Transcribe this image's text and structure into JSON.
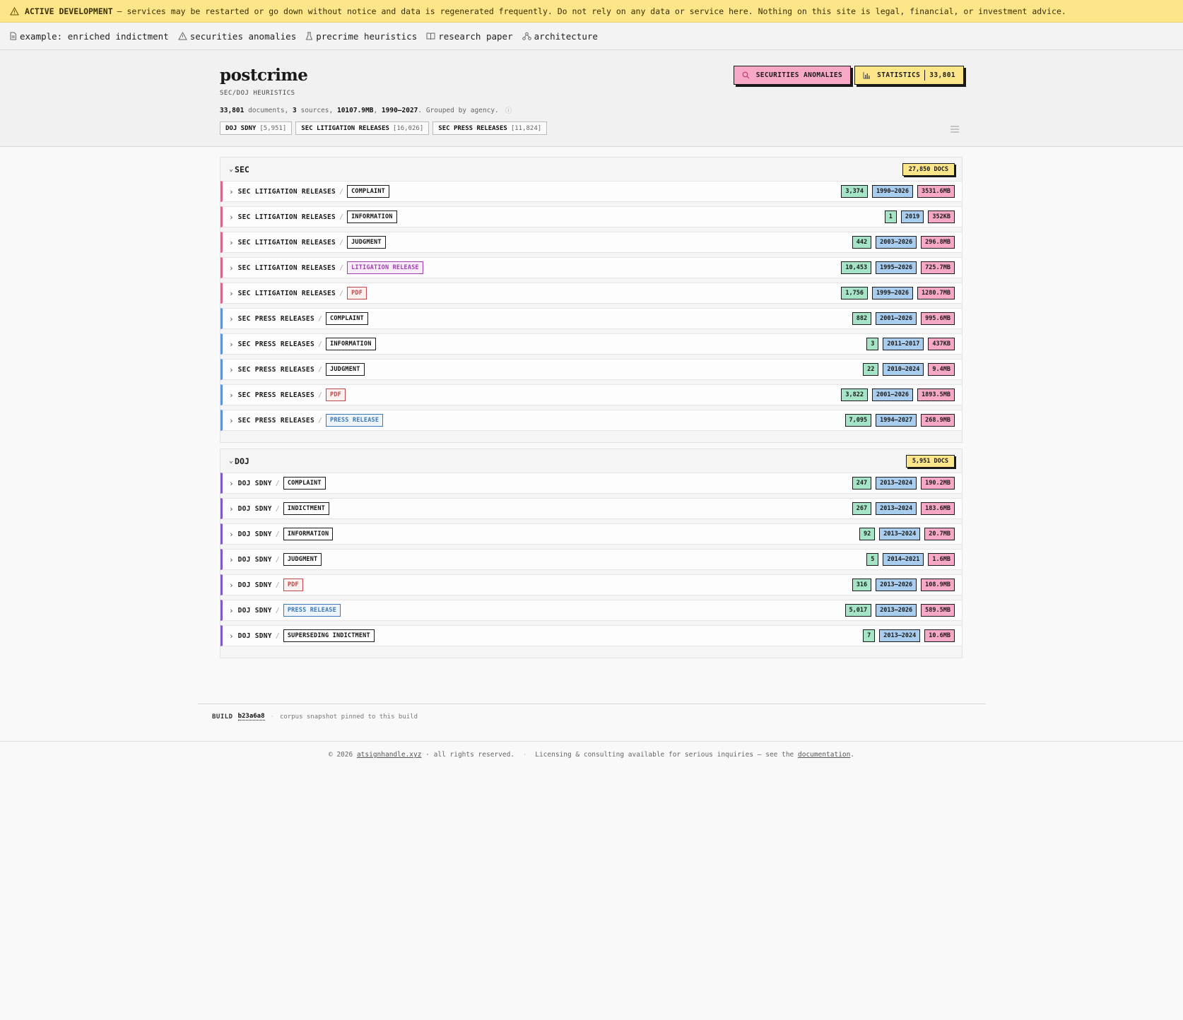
{
  "banner": {
    "icon": "warning-triangle-icon",
    "title": "ACTIVE DEVELOPMENT",
    "text": "— services may be restarted or go down without notice and data is regenerated frequently. Do not rely on any data or service here. Nothing on this site is legal, financial, or investment advice."
  },
  "nav": [
    {
      "icon": "file-icon",
      "label": "example: enriched indictment"
    },
    {
      "icon": "warning-icon",
      "label": "securities anomalies"
    },
    {
      "icon": "flask-icon",
      "label": "precrime heuristics"
    },
    {
      "icon": "book-icon",
      "label": "research paper"
    },
    {
      "icon": "network-icon",
      "label": "architecture"
    }
  ],
  "header": {
    "title": "postcrime",
    "subtitle": "SEC/DOJ HEURISTICS",
    "stats": {
      "documents": "33,801",
      "documents_label": "documents,",
      "sources": "3",
      "sources_label": "sources,",
      "size": "10107.9MB",
      "range": "1990–2027",
      "grouped": ". Grouped by agency."
    },
    "buttons": {
      "anomalies": "SECURITIES ANOMALIES",
      "statistics": "STATISTICS",
      "statistics_count": "33,801"
    },
    "sources": [
      {
        "name": "DOJ SDNY",
        "count": "[5,951]"
      },
      {
        "name": "SEC LITIGATION RELEASES",
        "count": "[16,026]"
      },
      {
        "name": "SEC PRESS RELEASES",
        "count": "[11,824]"
      }
    ]
  },
  "groups": [
    {
      "name": "SEC",
      "docs": "27,850 DOCS",
      "rows": [
        {
          "source": "SEC LITIGATION RELEASES",
          "tag": "COMPLAINT",
          "tag_style": "plain",
          "accent": "lit",
          "count": "3,374",
          "years": "1990–2026",
          "size": "3531.6MB"
        },
        {
          "source": "SEC LITIGATION RELEASES",
          "tag": "INFORMATION",
          "tag_style": "plain",
          "accent": "lit",
          "count": "1",
          "years": "2019",
          "size": "352KB"
        },
        {
          "source": "SEC LITIGATION RELEASES",
          "tag": "JUDGMENT",
          "tag_style": "plain",
          "accent": "lit",
          "count": "442",
          "years": "2003–2026",
          "size": "296.8MB"
        },
        {
          "source": "SEC LITIGATION RELEASES",
          "tag": "LITIGATION RELEASE",
          "tag_style": "lit",
          "accent": "lit",
          "count": "10,453",
          "years": "1995–2026",
          "size": "725.7MB"
        },
        {
          "source": "SEC LITIGATION RELEASES",
          "tag": "PDF",
          "tag_style": "pdf",
          "accent": "lit",
          "count": "1,756",
          "years": "1999–2026",
          "size": "1280.7MB"
        },
        {
          "source": "SEC PRESS RELEASES",
          "tag": "COMPLAINT",
          "tag_style": "plain",
          "accent": "press",
          "count": "882",
          "years": "2001–2026",
          "size": "995.6MB"
        },
        {
          "source": "SEC PRESS RELEASES",
          "tag": "INFORMATION",
          "tag_style": "plain",
          "accent": "press",
          "count": "3",
          "years": "2011–2017",
          "size": "437KB"
        },
        {
          "source": "SEC PRESS RELEASES",
          "tag": "JUDGMENT",
          "tag_style": "plain",
          "accent": "press",
          "count": "22",
          "years": "2010–2024",
          "size": "9.4MB"
        },
        {
          "source": "SEC PRESS RELEASES",
          "tag": "PDF",
          "tag_style": "pdf",
          "accent": "press",
          "count": "3,822",
          "years": "2001–2026",
          "size": "1893.5MB"
        },
        {
          "source": "SEC PRESS RELEASES",
          "tag": "PRESS RELEASE",
          "tag_style": "press",
          "accent": "press",
          "count": "7,095",
          "years": "1994–2027",
          "size": "268.9MB"
        }
      ]
    },
    {
      "name": "DOJ",
      "docs": "5,951 DOCS",
      "rows": [
        {
          "source": "DOJ SDNY",
          "tag": "COMPLAINT",
          "tag_style": "plain",
          "accent": "doj",
          "count": "247",
          "years": "2013–2024",
          "size": "190.2MB"
        },
        {
          "source": "DOJ SDNY",
          "tag": "INDICTMENT",
          "tag_style": "plain",
          "accent": "doj",
          "count": "267",
          "years": "2013–2024",
          "size": "183.6MB"
        },
        {
          "source": "DOJ SDNY",
          "tag": "INFORMATION",
          "tag_style": "plain",
          "accent": "doj",
          "count": "92",
          "years": "2013–2024",
          "size": "20.7MB"
        },
        {
          "source": "DOJ SDNY",
          "tag": "JUDGMENT",
          "tag_style": "plain",
          "accent": "doj",
          "count": "5",
          "years": "2014–2021",
          "size": "1.6MB"
        },
        {
          "source": "DOJ SDNY",
          "tag": "PDF",
          "tag_style": "pdf",
          "accent": "doj",
          "count": "316",
          "years": "2013–2026",
          "size": "108.9MB"
        },
        {
          "source": "DOJ SDNY",
          "tag": "PRESS RELEASE",
          "tag_style": "press",
          "accent": "doj",
          "count": "5,017",
          "years": "2013–2026",
          "size": "589.5MB"
        },
        {
          "source": "DOJ SDNY",
          "tag": "SUPERSEDING INDICTMENT",
          "tag_style": "plain",
          "accent": "doj",
          "count": "7",
          "years": "2013–2024",
          "size": "10.6MB"
        }
      ]
    }
  ],
  "build": {
    "label": "BUILD",
    "hash": "b23a6a8",
    "note": "corpus snapshot pinned to this build"
  },
  "footer": {
    "copyright": "© 2026",
    "site": "atsignhandle.xyz",
    "rights": "· all rights reserved.",
    "licensing": "Licensing & consulting available for serious inquiries — see the",
    "doc_link": "documentation",
    "end": "."
  },
  "colors": {
    "banner": "#fde58a",
    "accent_pink": "#f7a8c7",
    "badge_green": "#a6e4c8",
    "badge_blue": "#a9cdee",
    "badge_pink": "#f6a8c6",
    "lit_accent": "#d6688e",
    "press_accent": "#5b93d8",
    "doj_accent": "#7e58c9"
  }
}
